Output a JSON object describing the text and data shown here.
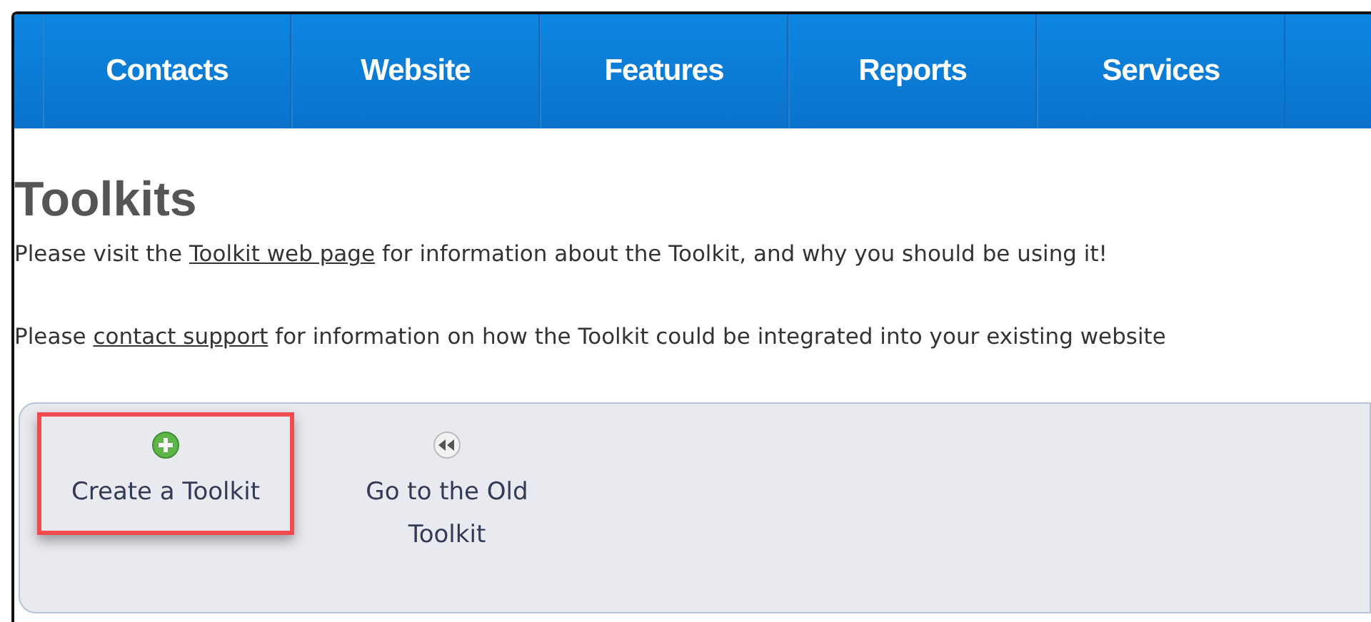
{
  "nav": {
    "items": [
      {
        "label": "Contacts"
      },
      {
        "label": "Website"
      },
      {
        "label": "Features"
      },
      {
        "label": "Reports"
      },
      {
        "label": "Services"
      }
    ]
  },
  "page": {
    "title": "Toolkits",
    "paragraphs": [
      {
        "before": "Please visit the ",
        "link": "Toolkit web page",
        "after": " for information about the Toolkit, and why you should be using it!"
      },
      {
        "before": "Please ",
        "link": "contact support",
        "after": " for information on how the Toolkit could be integrated into your existing website"
      }
    ]
  },
  "toolbar": {
    "buttons": [
      {
        "kind": "create",
        "label": "Create a Toolkit",
        "highlighted": true
      },
      {
        "kind": "back",
        "label": "Go to the Old Toolkit",
        "highlighted": false
      }
    ]
  }
}
